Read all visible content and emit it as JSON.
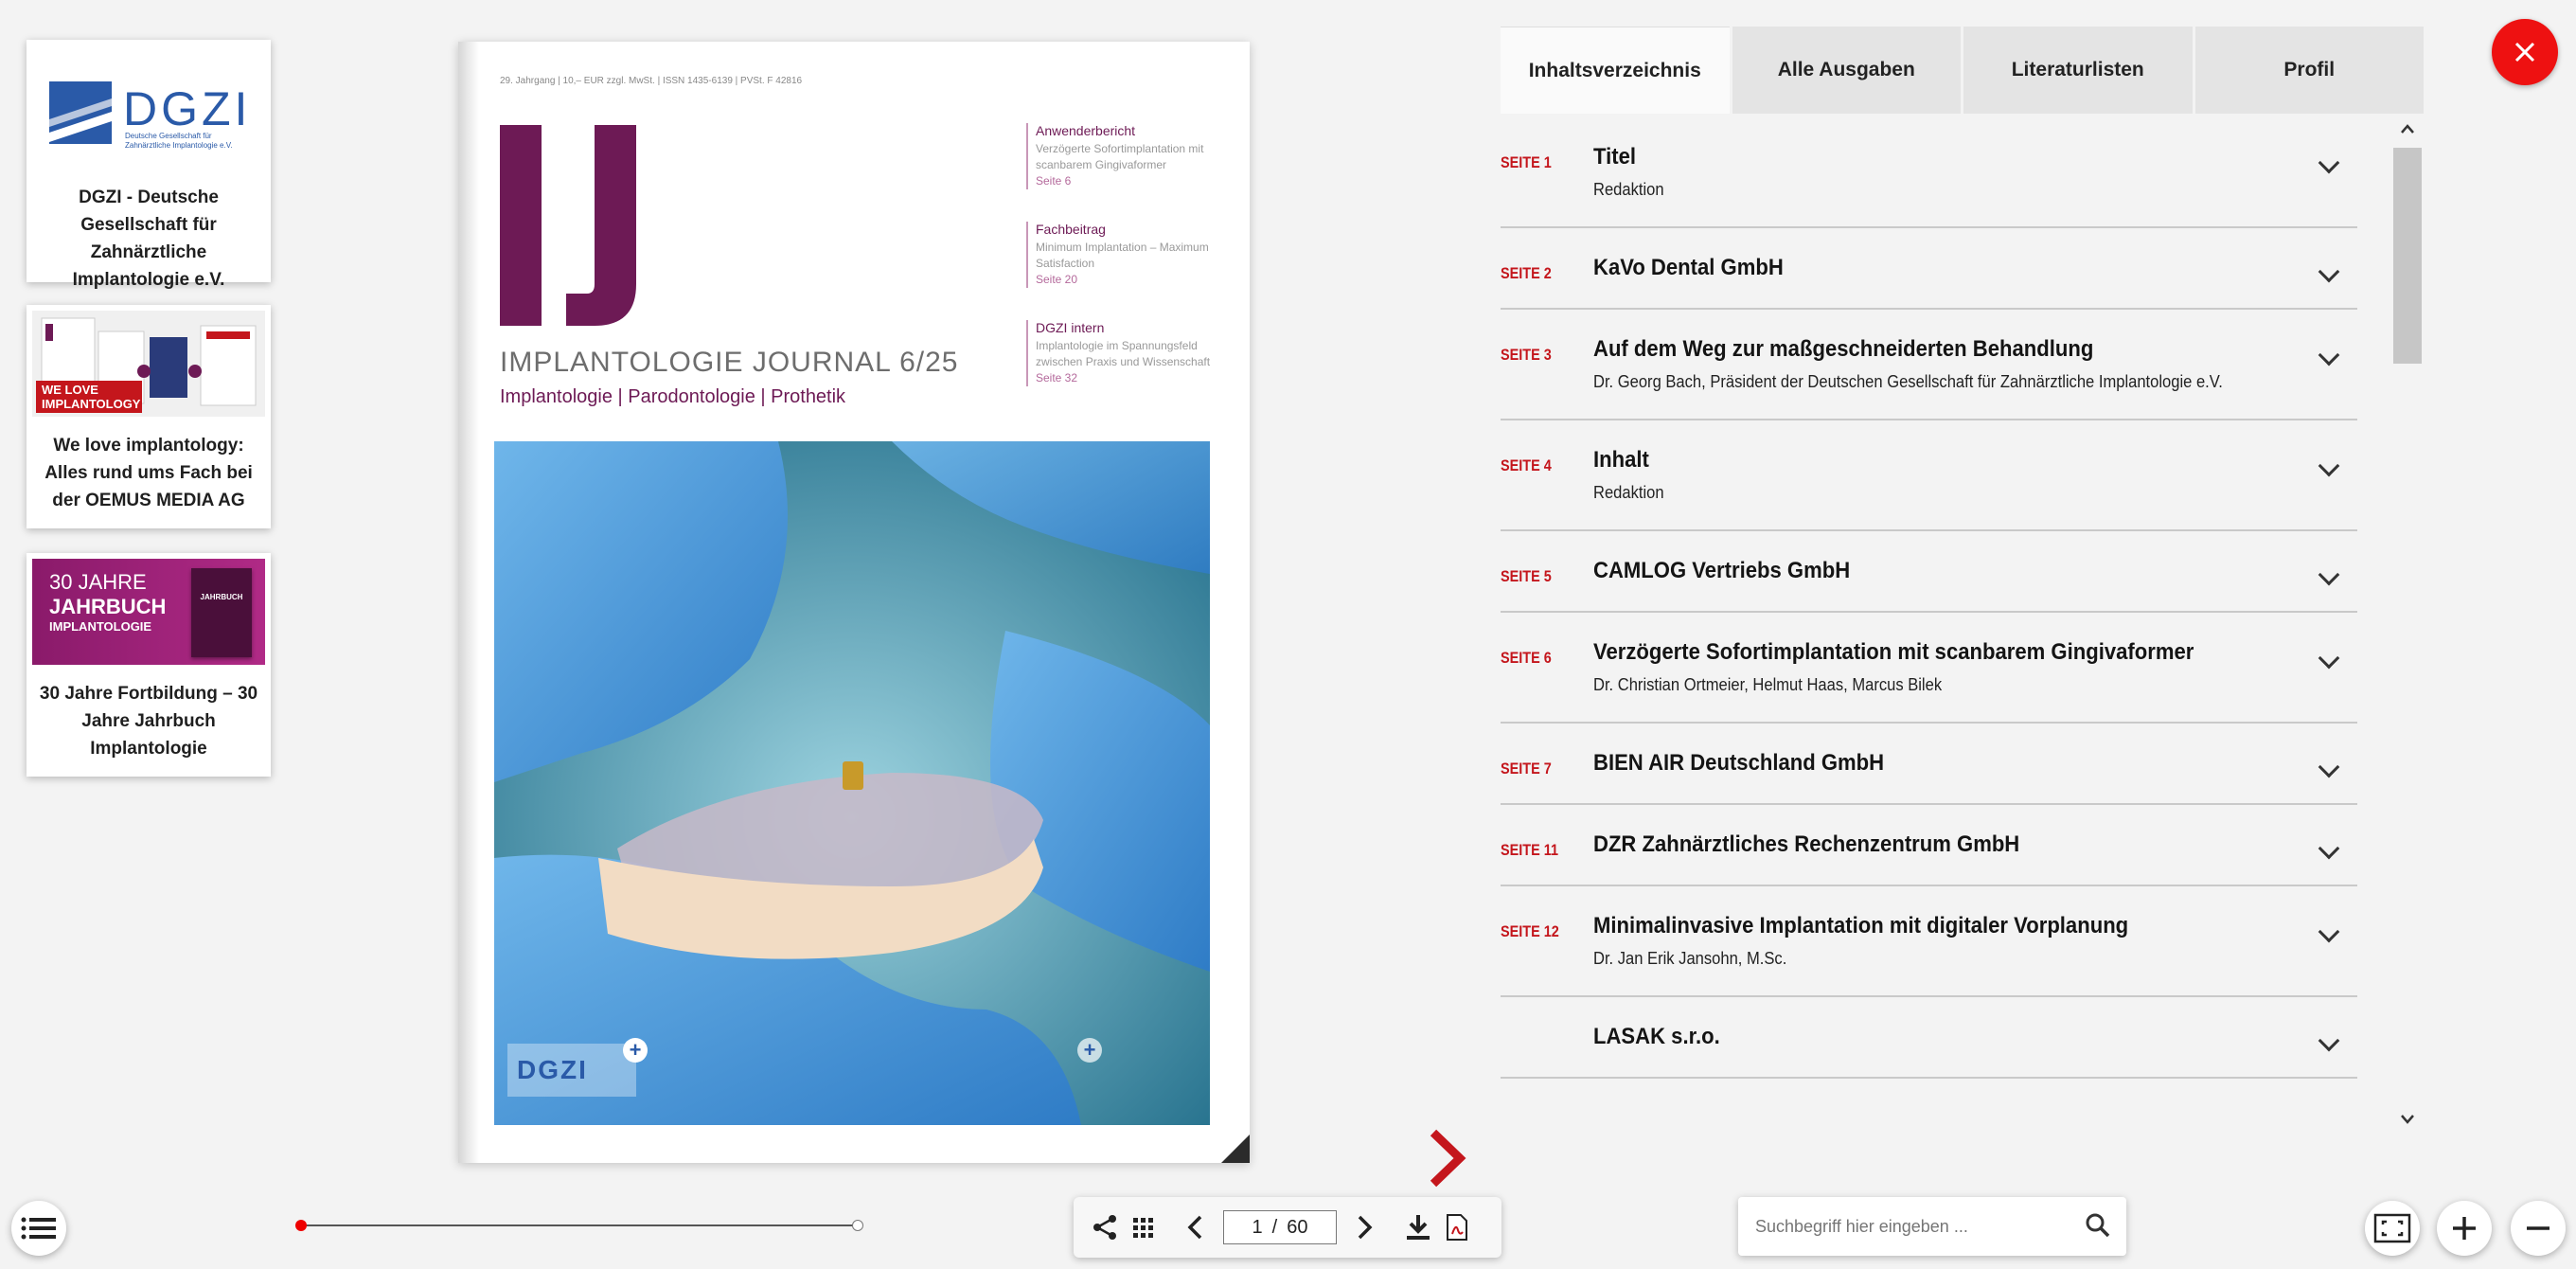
{
  "sidebar": {
    "cards": [
      {
        "caption": "DGZI - Deutsche Gesellschaft für Zahnärztliche Implantologie e.V.",
        "logo_text": "DGZI",
        "logo_sub": "Deutsche Gesellschaft für Zahnärztliche Implantologie e.V."
      },
      {
        "caption": "We love implantology: Alles rund ums Fach bei der OEMUS MEDIA AG",
        "badge": "WE LOVE IMPLANTOLOGY"
      },
      {
        "caption": "30 Jahre Fortbildung – 30 Jahre Jahrbuch Implantologie",
        "banner_line1": "30 JAHRE",
        "banner_line2": "JAHRBUCH",
        "banner_line3": "IMPLANTOLOGIE",
        "mini_title": "JAHRBUCH"
      }
    ]
  },
  "magazine": {
    "meta": "29. Jahrgang | 10,– EUR zzgl. MwSt. | ISSN 1435-6139 | PVSt. F 42816",
    "title": "IMPLANTOLOGIE JOURNAL 6/25",
    "subtitle": "Implantologie | Parodontologie | Prothetik",
    "teasers": [
      {
        "head": "Anwenderbericht",
        "desc": "Verzögerte Sofortimplantation mit scanbarem Gingivaformer",
        "page": "Seite 6"
      },
      {
        "head": "Fachbeitrag",
        "desc": "Minimum Implantation – Maximum Satisfaction",
        "page": "Seite 20"
      },
      {
        "head": "DGZI intern",
        "desc": "Implantologie im Spannungsfeld zwischen Praxis und Wissenschaft",
        "page": "Seite 32"
      }
    ],
    "cover_logo_text": "DGZI"
  },
  "tabs": [
    {
      "label": "Inhaltsverzeichnis",
      "active": true
    },
    {
      "label": "Alle Ausgaben",
      "active": false
    },
    {
      "label": "Literaturlisten",
      "active": false
    },
    {
      "label": "Profil",
      "active": false
    }
  ],
  "toc": [
    {
      "page": "SEITE 1",
      "title": "Titel",
      "author": "Redaktion"
    },
    {
      "page": "SEITE 2",
      "title": "KaVo Dental GmbH",
      "author": ""
    },
    {
      "page": "SEITE 3",
      "title": "Auf dem Weg zur maßgeschneiderten Behandlung",
      "author": "Dr. Georg Bach, Präsident der Deutschen Gesellschaft für Zahnärztliche Implantologie e.V."
    },
    {
      "page": "SEITE 4",
      "title": "Inhalt",
      "author": "Redaktion"
    },
    {
      "page": "SEITE 5",
      "title": "CAMLOG Vertriebs GmbH",
      "author": ""
    },
    {
      "page": "SEITE 6",
      "title": "Verzögerte Sofortimplantation mit scanbarem Gingivaformer",
      "author": "Dr. Christian Ortmeier, Helmut Haas, Marcus Bilek"
    },
    {
      "page": "SEITE 7",
      "title": "BIEN AIR Deutschland GmbH",
      "author": ""
    },
    {
      "page": "SEITE 11",
      "title": "DZR Zahnärztliches Rechenzentrum GmbH",
      "author": ""
    },
    {
      "page": "SEITE 12",
      "title": "Minimalinvasive Implantation mit digitaler Vorplanung",
      "author": "Dr. Jan Erik Jansohn, M.Sc."
    },
    {
      "page": "",
      "title": "LASAK s.r.o.",
      "author": ""
    }
  ],
  "pager": {
    "current": "1",
    "separator": "/",
    "total": "60"
  },
  "progress": 0.0,
  "search": {
    "placeholder": "Suchbegriff hier eingeben ..."
  },
  "colors": {
    "accent_red": "#c4161c",
    "close_red": "#ee1111",
    "journal_purple": "#6d1a55"
  }
}
